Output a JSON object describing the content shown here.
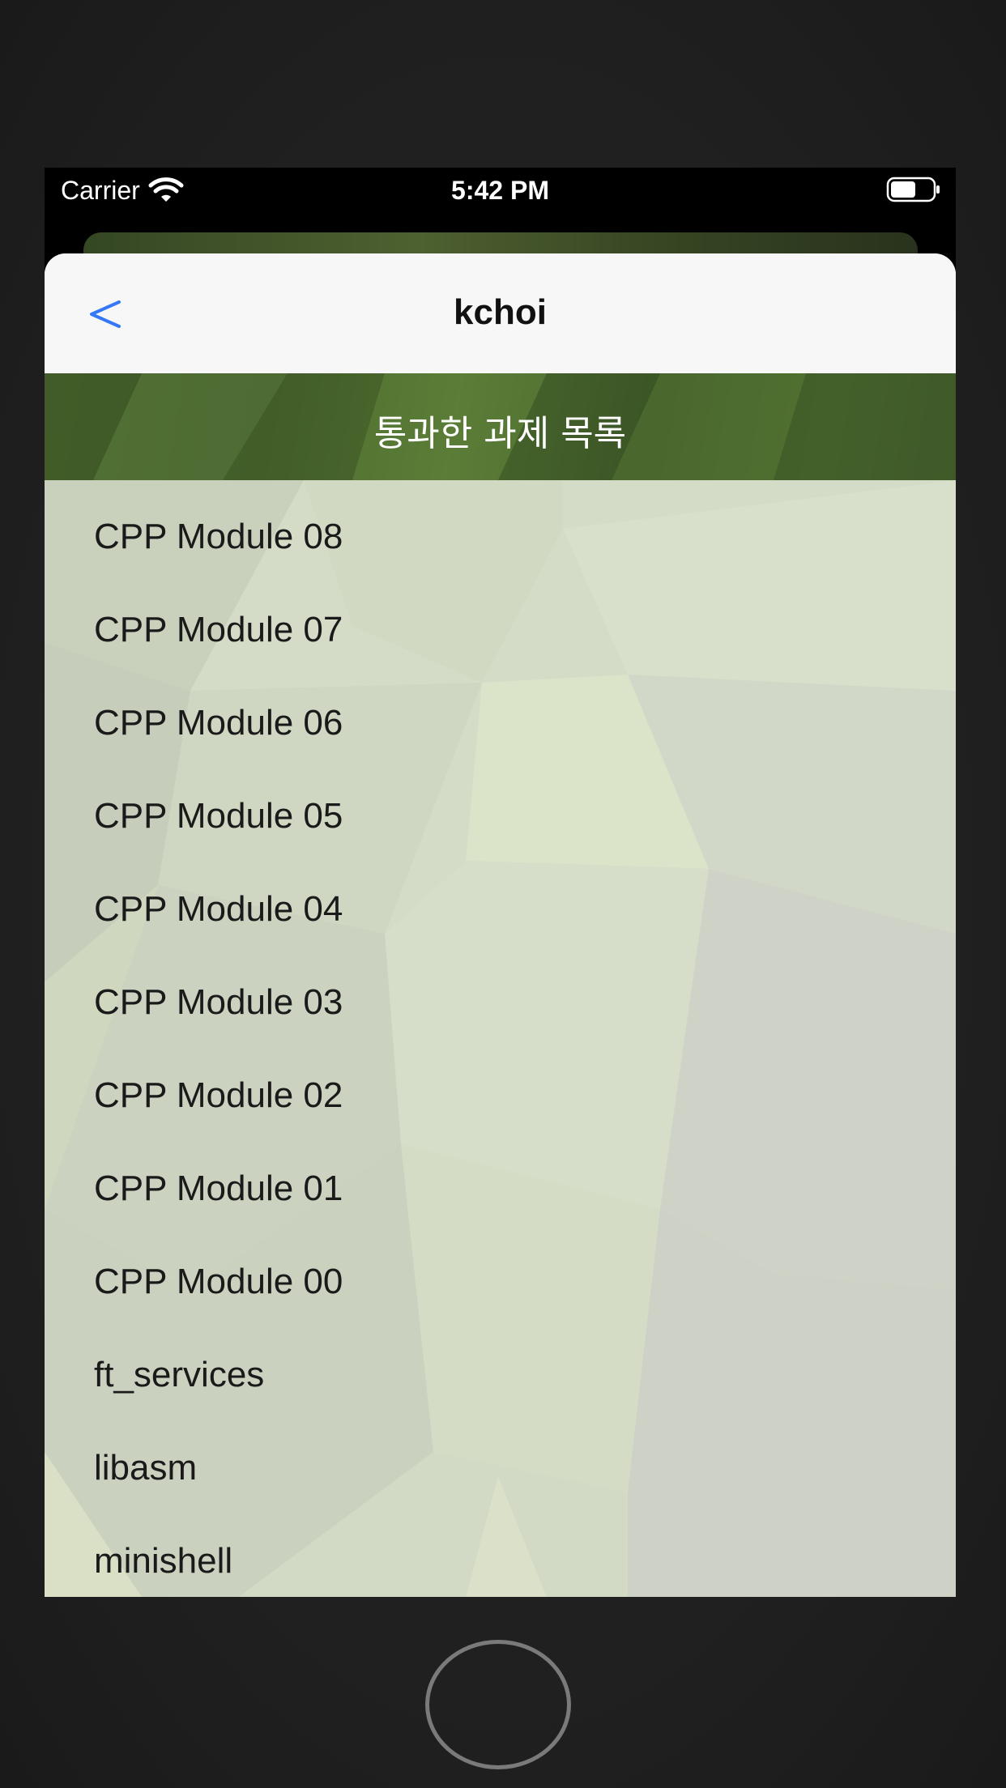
{
  "status_bar": {
    "carrier": "Carrier",
    "time": "5:42 PM",
    "wifi_icon": "wifi-icon",
    "battery_icon": "battery-icon"
  },
  "nav": {
    "title": "kchoi",
    "back_icon": "chevron-left-icon",
    "accent_color": "#3478f6"
  },
  "section": {
    "title": "통과한 과제 목록"
  },
  "projects": [
    "CPP Module 08",
    "CPP Module 07",
    "CPP Module 06",
    "CPP Module 05",
    "CPP Module 04",
    "CPP Module 03",
    "CPP Module 02",
    "CPP Module 01",
    "CPP Module 00",
    "ft_services",
    "libasm",
    "minishell"
  ]
}
